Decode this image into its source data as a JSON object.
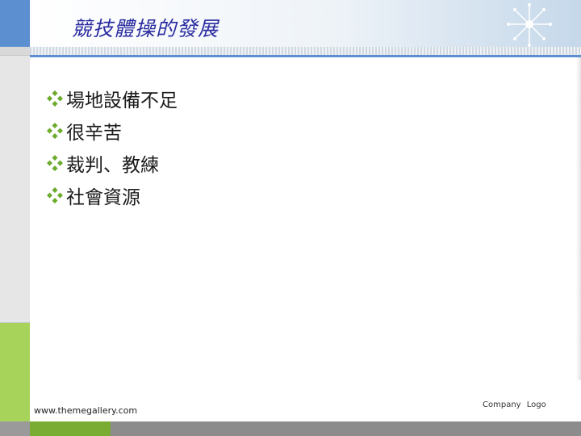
{
  "slide": {
    "title": "競技體操的發展",
    "bullets": [
      {
        "text": "場地設備不足"
      },
      {
        "text": "很辛苦"
      },
      {
        "text": "裁判、教練"
      },
      {
        "text": "社會資源"
      }
    ],
    "footer_url": "www.themegallery.com",
    "company_logo": "Company Logo"
  },
  "colors": {
    "title": "#2a2ca0",
    "bullet_icon": "#6cab2c",
    "accent_blue": "#5b8fd0",
    "accent_green": "#a8d35a"
  },
  "icons": {
    "bullet": "diamond-bullet-icon",
    "logo": "sunburst-logo-icon"
  }
}
